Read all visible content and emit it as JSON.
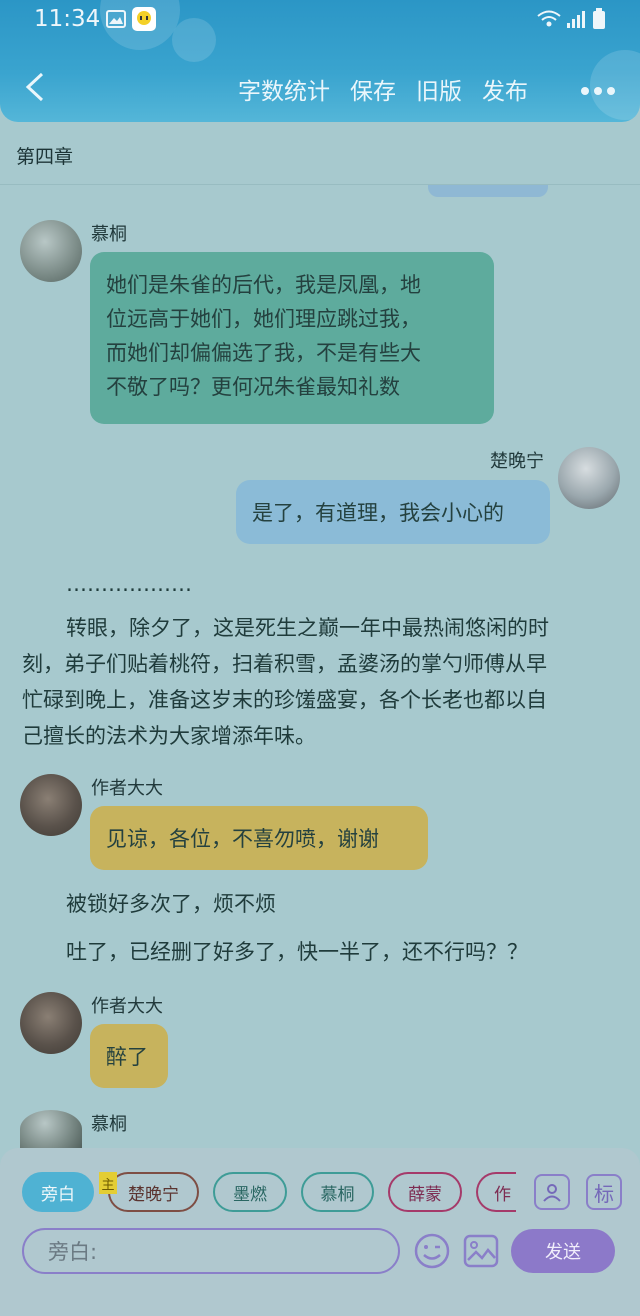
{
  "status_bar": {
    "time": "11:34"
  },
  "header": {
    "back_icon": "chevron-left-icon",
    "actions": [
      "字数统计",
      "保存",
      "旧版",
      "发布"
    ],
    "more_icon": "more-dots-icon"
  },
  "chapter": {
    "title": "第四章"
  },
  "messages": [
    {
      "speaker": "慕桐",
      "text_lines": [
        "她们是朱雀的后代，我是凤凰，地",
        "位远高于她们，她们理应跳过我，",
        "而她们却偏偏选了我，不是有些大",
        "不敬了吗？更何况朱雀最知礼数"
      ]
    },
    {
      "speaker": "楚晚宁",
      "text": "是了，有道理，我会小心的"
    },
    {
      "speaker": "作者大大",
      "text": "见谅，各位，不喜勿喷，谢谢"
    },
    {
      "speaker": "作者大大",
      "text": "醉了"
    },
    {
      "speaker": "慕桐"
    }
  ],
  "narration": {
    "ellipsis": "………………",
    "para_lines": [
      "转眼，除夕了，这是死生之巅一年中最热闹悠闲的时",
      "刻，弟子们贴着桃符，扫着积雪，孟婆汤的掌勺师傅从早",
      "忙碌到晚上，准备这岁末的珍馐盛宴，各个长老也都以自",
      "己擅长的法术为大家增添年味。"
    ],
    "line1": "被锁好多次了，烦不烦",
    "line2": "吐了，已经删了好多了，快一半了，还不行吗？？"
  },
  "composer": {
    "chips": [
      "旁白",
      "楚晚宁",
      "墨燃",
      "慕桐",
      "薛蒙",
      "作"
    ],
    "main_tag": "主",
    "role_icon": "person-card-icon",
    "tag_button": "标",
    "input_placeholder": "旁白:",
    "emoji_icon": "emoji-icon",
    "image_icon": "image-icon",
    "send": "发送"
  },
  "colors": {
    "header": "#2b96c6",
    "bubble_teal": "#5eab9d",
    "bubble_blue": "#8bbbd7",
    "bubble_yellow": "#c7b35d",
    "send": "#8c79c9"
  }
}
